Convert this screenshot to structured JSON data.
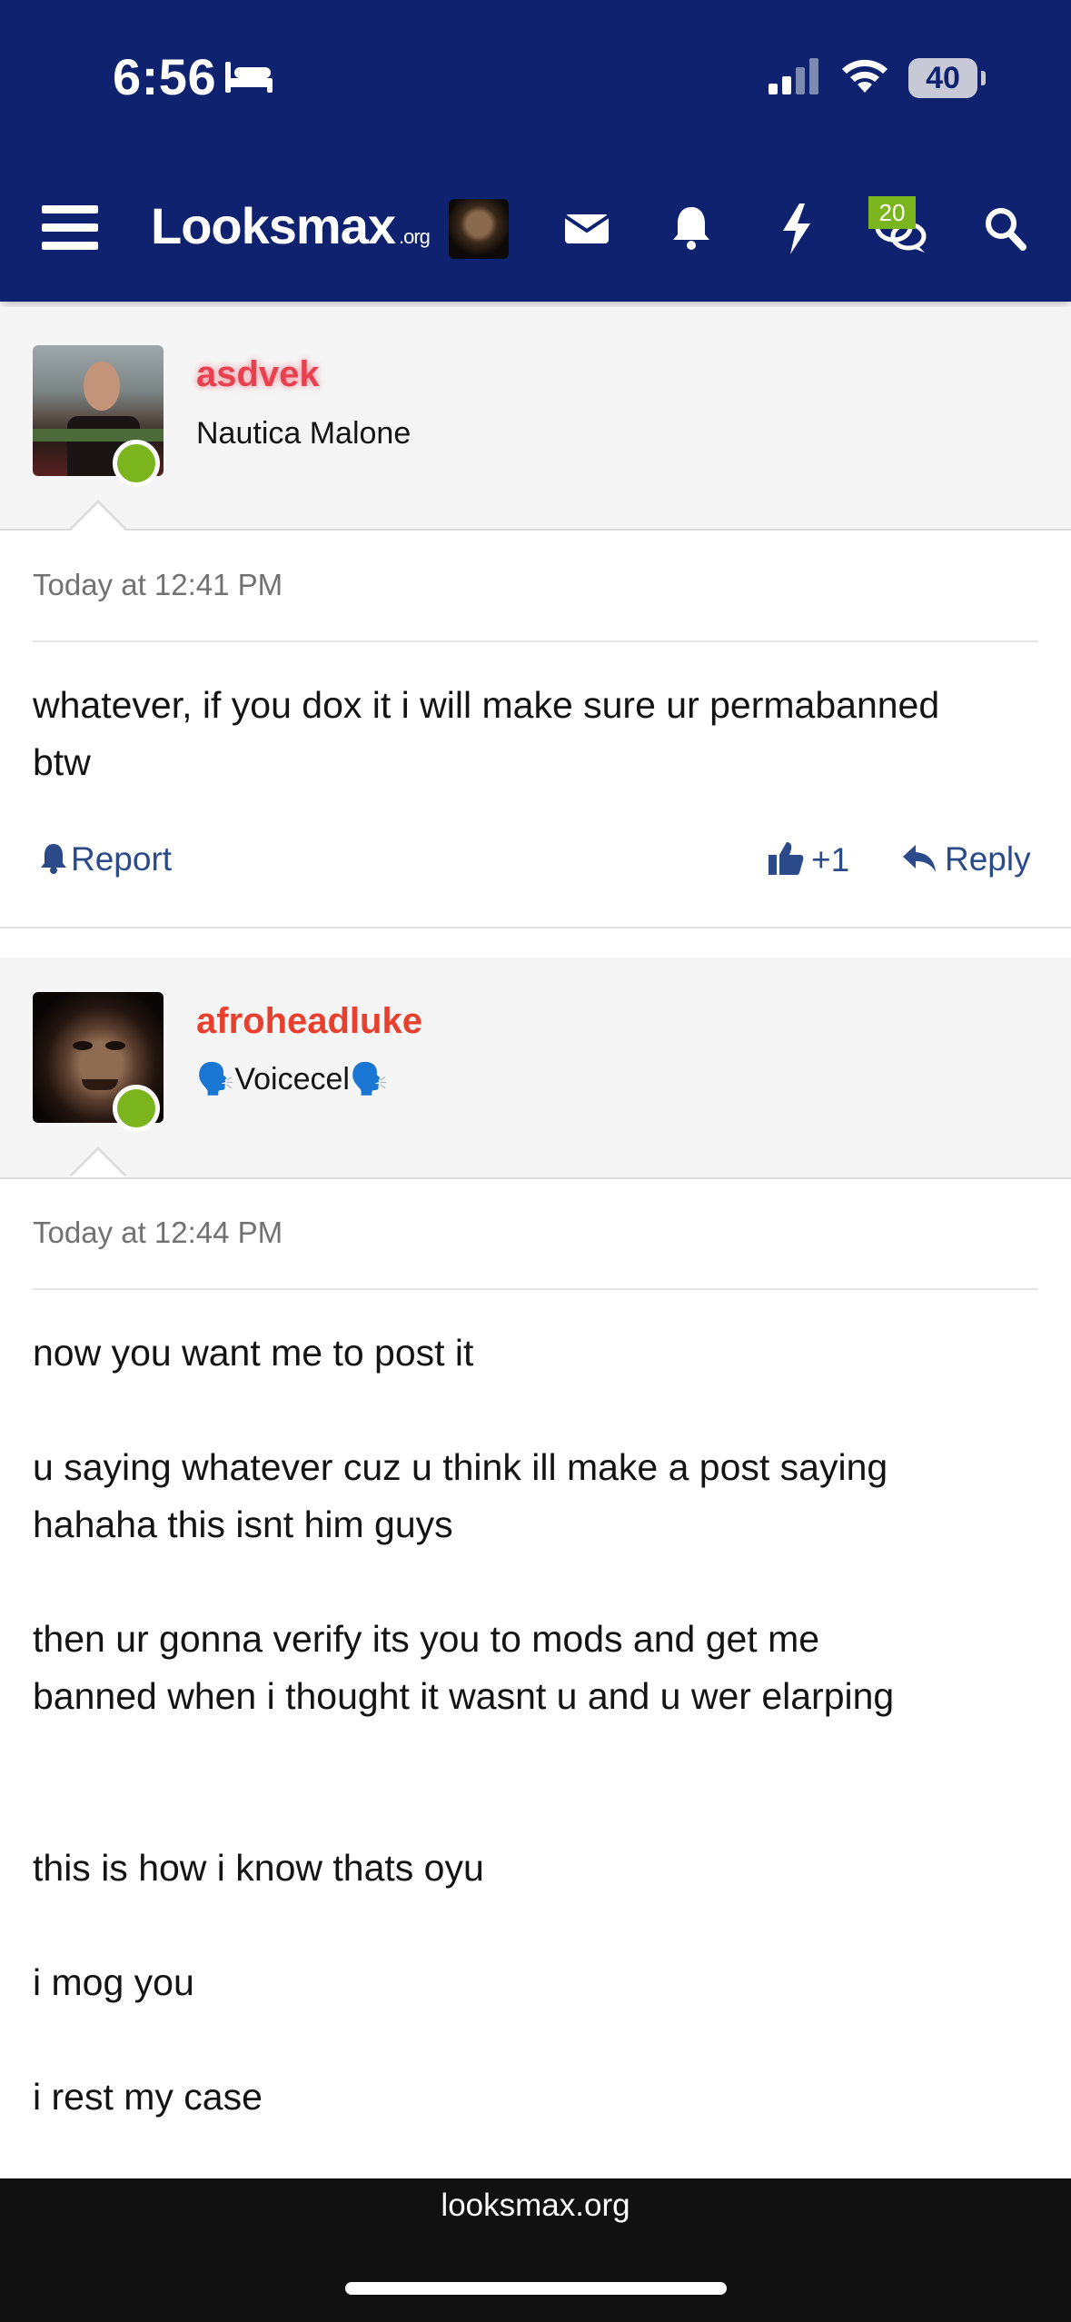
{
  "status_bar": {
    "time": "6:56",
    "battery": "40",
    "icons": [
      "bed-icon",
      "signal-icon",
      "wifi-icon",
      "battery-icon"
    ]
  },
  "nav": {
    "logo_main": "Looksmax",
    "logo_suffix": ".org",
    "messages_badge": "20",
    "icons": [
      "menu-icon",
      "avatar",
      "envelope-icon",
      "bell-icon",
      "bolt-icon",
      "chat-bubbles-icon",
      "search-icon"
    ],
    "colors": {
      "bar": "#0e2270",
      "badge": "#7ab51d"
    }
  },
  "posts": [
    {
      "username": "asdvek",
      "username_color": "#e8404f",
      "user_title": "Nautica Malone",
      "date": "Today at 12:41 PM",
      "body": "whatever, if you dox it i will make sure ur permabanned\nbtw",
      "actions": {
        "report": "Report",
        "likes": "+1",
        "reply": "Reply"
      }
    },
    {
      "username": "afroheadluke",
      "username_color": "#e8402e",
      "user_title": "🗣️Voicecel🗣️",
      "date": "Today at 12:44 PM",
      "body": "now you want me to post it\n\nu saying whatever cuz u think ill make a post saying\nhahaha this isnt him guys\n\nthen ur gonna verify its you to mods and get me\nbanned when i thought it wasnt u and u wer elarping\n\n\nthis is how i know thats oyu\n\ni mog you\n\ni rest my case"
    }
  ],
  "browser": {
    "url": "looksmax.org"
  }
}
